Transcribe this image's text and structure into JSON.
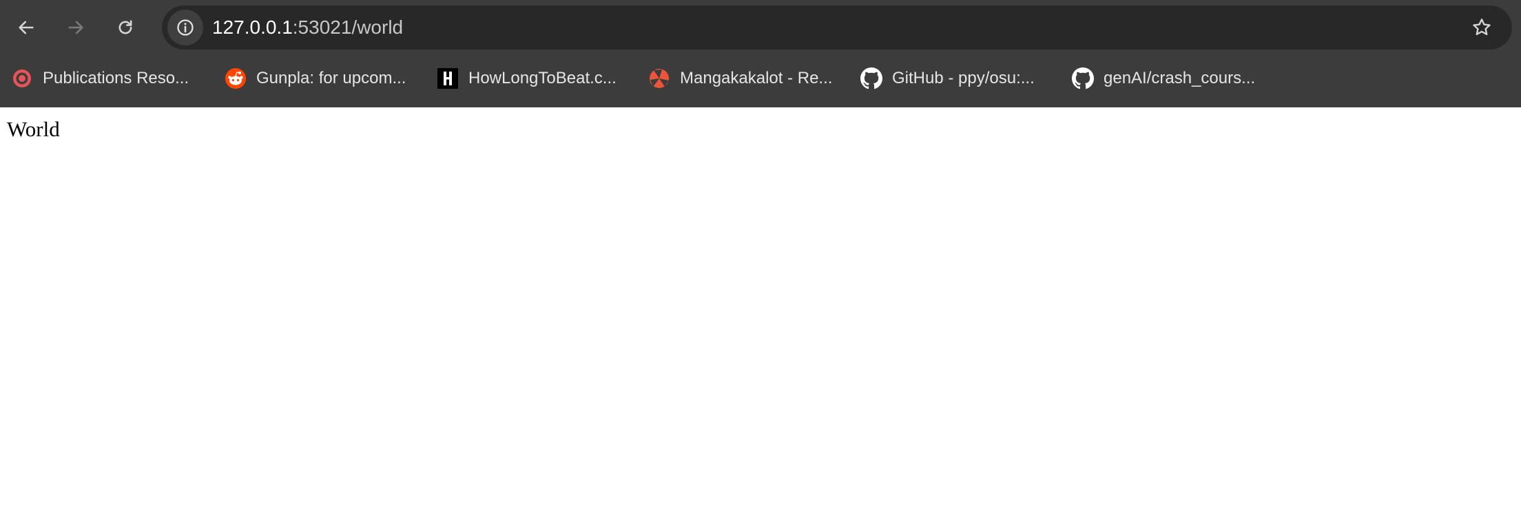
{
  "browser": {
    "url_host": "127.0.0.1",
    "url_rest": ":53021/world",
    "icons": {
      "back": "back-arrow-icon",
      "forward": "forward-arrow-icon",
      "reload": "reload-icon",
      "site_info": "info-icon",
      "bookmark_star": "star-icon"
    },
    "colors": {
      "chrome_bg": "#3c3c3c",
      "omnibox_bg": "#282828",
      "text": "#e6e6e6"
    }
  },
  "bookmarks": [
    {
      "label": "Publications Reso...",
      "icon": "target-icon",
      "color": "#e8545a"
    },
    {
      "label": "Gunpla: for upcom...",
      "icon": "reddit-icon",
      "color": "#ff4500"
    },
    {
      "label": "HowLongToBeat.c...",
      "icon": "hltb-icon",
      "color": "#000000"
    },
    {
      "label": "Mangakakalot - Re...",
      "icon": "mangakakalot-icon",
      "color": "#e8553a"
    },
    {
      "label": "GitHub - ppy/osu:...",
      "icon": "github-icon",
      "color": "#ffffff"
    },
    {
      "label": "genAI/crash_cours...",
      "icon": "github-icon",
      "color": "#ffffff"
    }
  ],
  "page": {
    "body_text": "World"
  }
}
